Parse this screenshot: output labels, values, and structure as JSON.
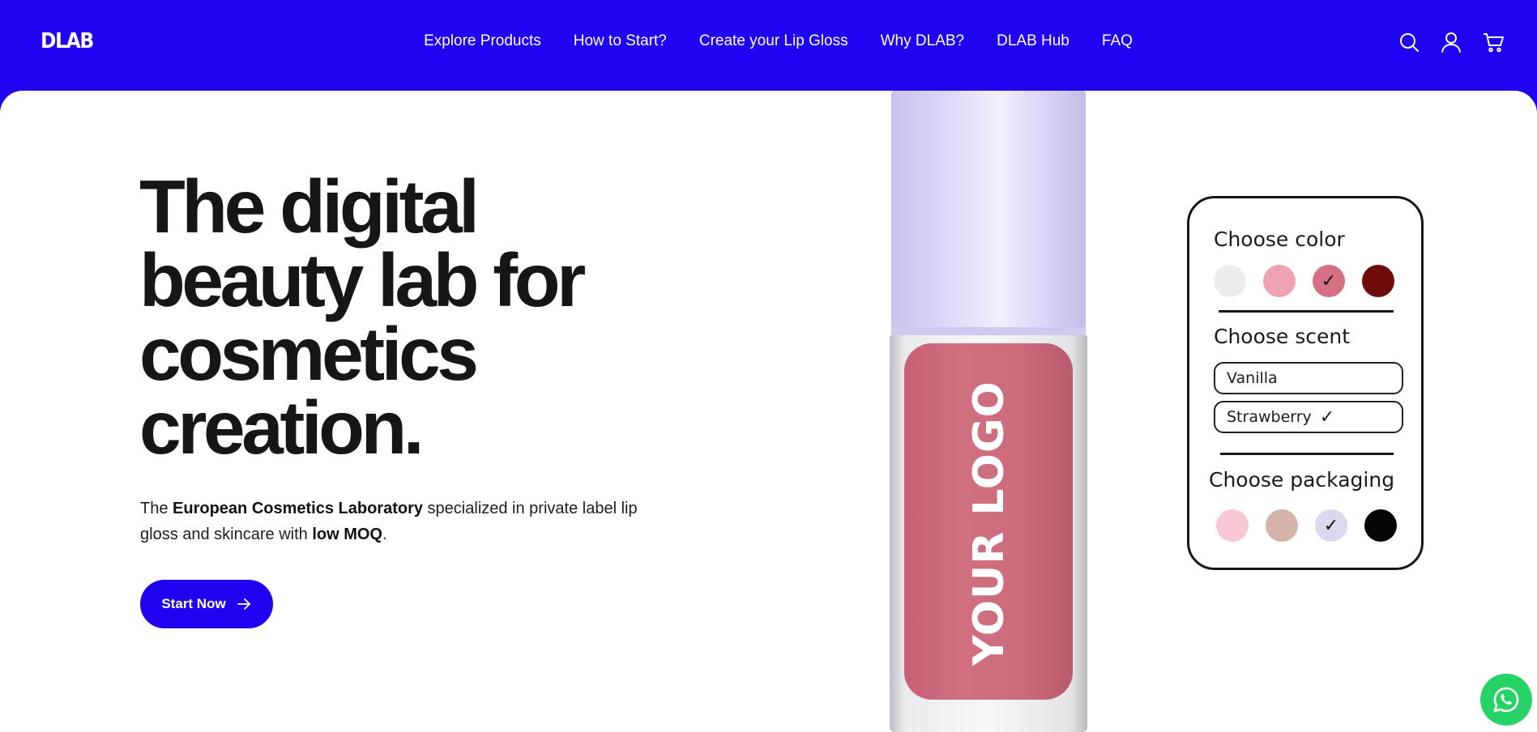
{
  "header": {
    "logo": "DLAB",
    "nav": [
      "Explore Products",
      "How to Start?",
      "Create your Lip Gloss",
      "Why DLAB?",
      "DLAB Hub",
      "FAQ"
    ],
    "icons": [
      "search-icon",
      "account-icon",
      "cart-icon"
    ]
  },
  "hero": {
    "headline": [
      "The digital",
      "beauty lab for",
      "cosmetics",
      "creation."
    ],
    "subtitle": {
      "t1": "The ",
      "b1": "European Cosmetics Laboratory",
      "t2": " specialized in private label lip gloss and skincare with ",
      "b2": "low MOQ",
      "t3": "."
    },
    "cta": "Start Now"
  },
  "product": {
    "logo_text": "YOUR LOGO"
  },
  "configurator": {
    "color_title": "Choose color",
    "colors": [
      {
        "hex": "#efeced",
        "selected": false
      },
      {
        "hex": "#efa2b3",
        "selected": false
      },
      {
        "hex": "#d56f84",
        "selected": true
      },
      {
        "hex": "#6e0b0b",
        "selected": false
      }
    ],
    "scent_title": "Choose scent",
    "scents": [
      {
        "label": "Vanilla",
        "selected": false
      },
      {
        "label": "Strawberry",
        "selected": true
      }
    ],
    "packaging_title": "Choose packaging",
    "packaging": [
      {
        "hex": "#f9c8d4",
        "selected": false
      },
      {
        "hex": "#d6b3a8",
        "selected": false
      },
      {
        "hex": "#dcd8ef",
        "selected": true
      },
      {
        "hex": "#050505",
        "selected": false
      }
    ],
    "check_glyph": "✓"
  },
  "colors": {
    "brand": "#1f02ef",
    "whatsapp": "#25d366"
  }
}
